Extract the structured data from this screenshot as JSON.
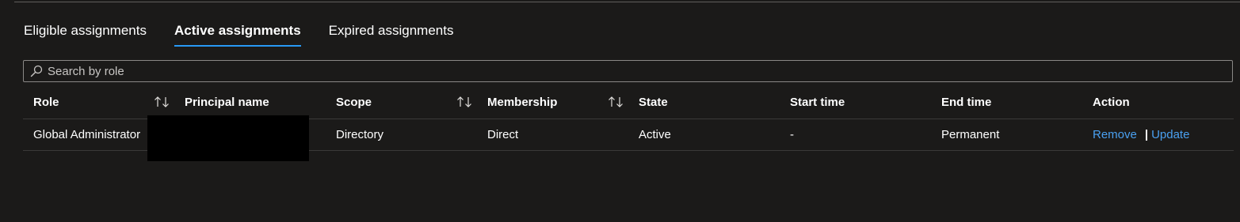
{
  "tabs": [
    {
      "label": "Eligible assignments",
      "active": false
    },
    {
      "label": "Active assignments",
      "active": true
    },
    {
      "label": "Expired assignments",
      "active": false
    }
  ],
  "search": {
    "placeholder": "Search by role",
    "value": "",
    "icon": "search-icon"
  },
  "table": {
    "columns": [
      {
        "label": "Role",
        "sortable": true
      },
      {
        "label": "Principal name",
        "sortable": false
      },
      {
        "label": "Scope",
        "sortable": true
      },
      {
        "label": "Membership",
        "sortable": true
      },
      {
        "label": "State",
        "sortable": false
      },
      {
        "label": "Start time",
        "sortable": false
      },
      {
        "label": "End time",
        "sortable": false
      },
      {
        "label": "Action",
        "sortable": false
      }
    ],
    "rows": [
      {
        "role": "Global Administrator",
        "principal_name": "",
        "scope": "Directory",
        "membership": "Direct",
        "state": "Active",
        "start_time": "-",
        "end_time": "Permanent",
        "actions": {
          "remove": "Remove",
          "separator": "|",
          "update": "Update"
        }
      }
    ]
  },
  "colors": {
    "background": "#1b1a19",
    "accent": "#2899f5",
    "link": "#4aa0f0"
  }
}
